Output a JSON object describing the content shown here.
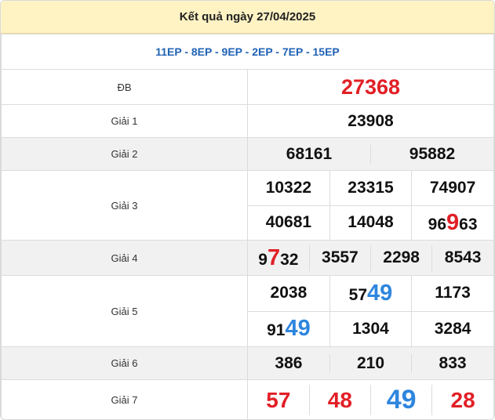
{
  "header": {
    "title": "Kết quả ngày 27/04/2025"
  },
  "codes": "11EP - 8EP - 9EP - 2EP - 7EP - 15EP",
  "prizes": {
    "db": {
      "label": "ĐB",
      "value": "27368"
    },
    "g1": {
      "label": "Giải 1",
      "value": "23908"
    },
    "g2": {
      "label": "Giải 2",
      "values": [
        "68161",
        "95882"
      ]
    },
    "g3": {
      "label": "Giải 3",
      "values": [
        "10322",
        "23315",
        "74907",
        "40681",
        "14048",
        "96963"
      ],
      "highlight_6": {
        "pre": "96",
        "hl": "9",
        "post": "63"
      }
    },
    "g4": {
      "label": "Giải 4",
      "values": [
        "9732",
        "3557",
        "2298",
        "8543"
      ],
      "highlight_1": {
        "pre": "9",
        "hl": "7",
        "post": "32"
      }
    },
    "g5": {
      "label": "Giải 5",
      "values": [
        "2038",
        "5749",
        "1173",
        "9149",
        "1304",
        "3284"
      ],
      "highlight_2": {
        "pre": "57",
        "hl": "49"
      },
      "highlight_4": {
        "pre": "91",
        "hl": "49"
      }
    },
    "g6": {
      "label": "Giải 6",
      "values": [
        "386",
        "210",
        "833"
      ]
    },
    "g7": {
      "label": "Giải 7",
      "values": [
        "57",
        "48",
        "49",
        "28"
      ]
    }
  },
  "colors": {
    "red": "#e21f26",
    "blue": "#2e86de",
    "code_blue": "#1f62b4",
    "header_bg": "#fff3c4"
  }
}
